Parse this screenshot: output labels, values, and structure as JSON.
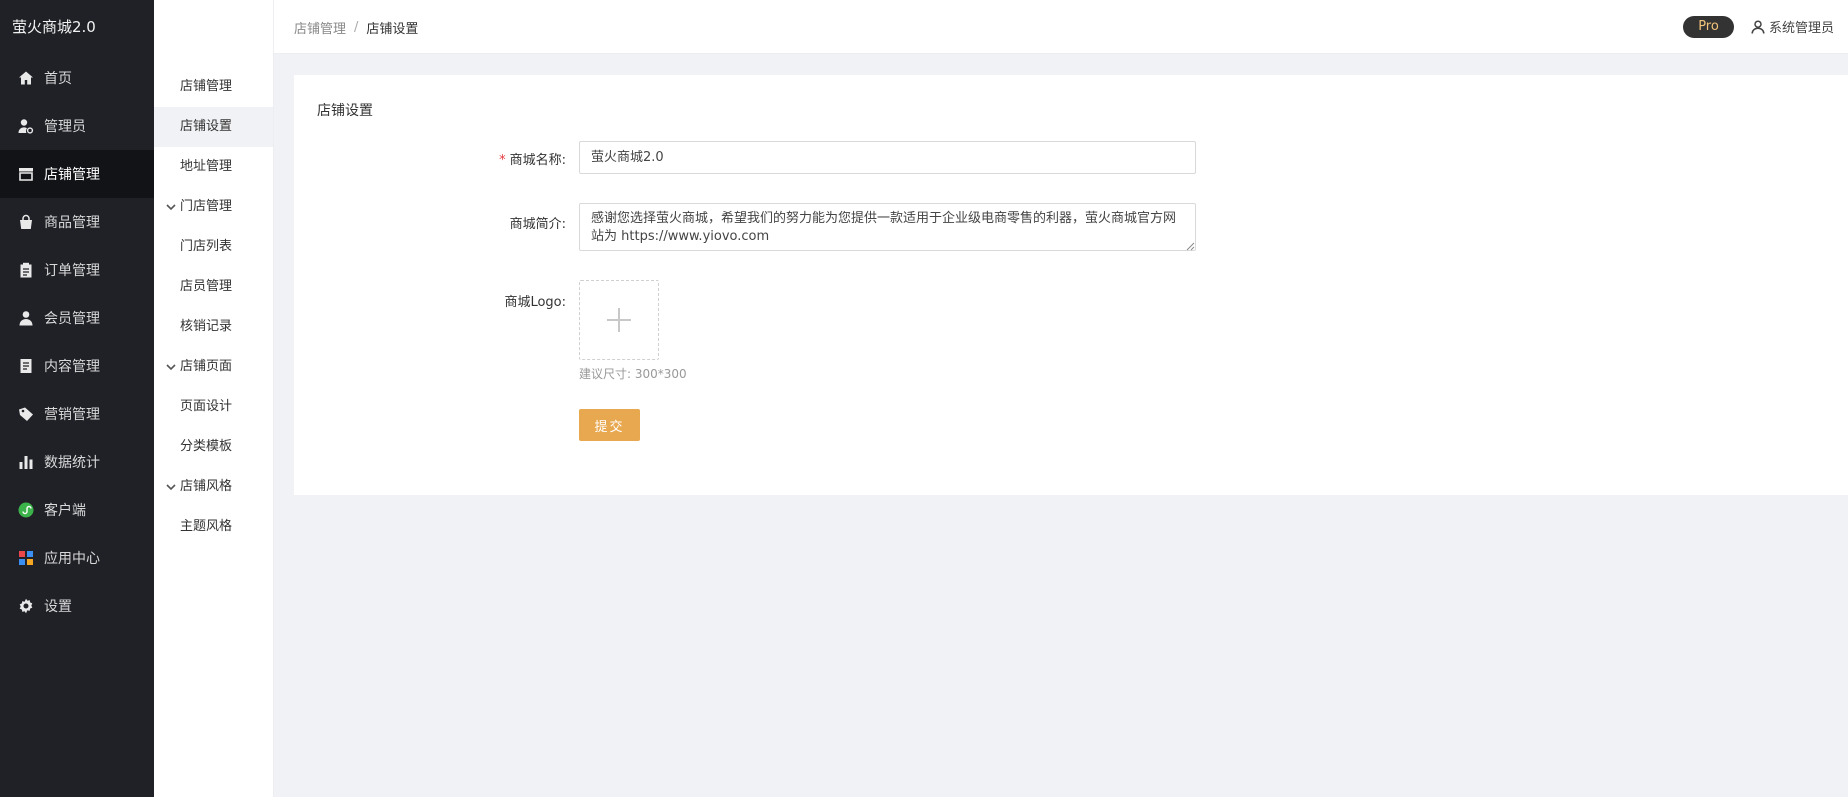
{
  "brand": "萤火商城2.0",
  "sidebar": {
    "items": [
      {
        "label": "首页",
        "icon": "home-icon"
      },
      {
        "label": "管理员",
        "icon": "admin-user-icon"
      },
      {
        "label": "店铺管理",
        "icon": "store-icon",
        "active": true
      },
      {
        "label": "商品管理",
        "icon": "shopping-bag-icon"
      },
      {
        "label": "订单管理",
        "icon": "clipboard-icon"
      },
      {
        "label": "会员管理",
        "icon": "member-icon"
      },
      {
        "label": "内容管理",
        "icon": "document-icon"
      },
      {
        "label": "营销管理",
        "icon": "tag-icon"
      },
      {
        "label": "数据统计",
        "icon": "bar-chart-icon"
      },
      {
        "label": "客户端",
        "icon": "client-icon"
      },
      {
        "label": "应用中心",
        "icon": "apps-icon"
      },
      {
        "label": "设置",
        "icon": "gear-icon"
      }
    ]
  },
  "subbar": {
    "store_manage": "店铺管理",
    "store_settings": "店铺设置",
    "address_manage": "地址管理",
    "shop_group": "门店管理",
    "shop_list": "门店列表",
    "clerk_manage": "店员管理",
    "verify_records": "核销记录",
    "page_group": "店铺页面",
    "page_design": "页面设计",
    "category_template": "分类模板",
    "style_group": "店铺风格",
    "theme_style": "主题风格"
  },
  "header": {
    "breadcrumb_parent": "店铺管理",
    "breadcrumb_sep": "/",
    "breadcrumb_current": "店铺设置",
    "pro_badge": "Pro",
    "username": "系统管理员"
  },
  "form": {
    "card_title": "店铺设置",
    "required_mark": "*",
    "name_label": "商城名称:",
    "name_value": "萤火商城2.0",
    "intro_label": "商城简介:",
    "intro_value": "感谢您选择萤火商城，希望我们的努力能为您提供一款适用于企业级电商零售的利器，萤火商城官方网站为 https://www.yiovo.com",
    "logo_label": "商城Logo:",
    "logo_hint": "建议尺寸: 300*300",
    "submit_label": "提交"
  },
  "colors": {
    "sidebar_bg": "#1f2127",
    "accent": "#e8a84f",
    "pro_badge_bg": "#333333",
    "pro_badge_text": "#f2c37a"
  }
}
